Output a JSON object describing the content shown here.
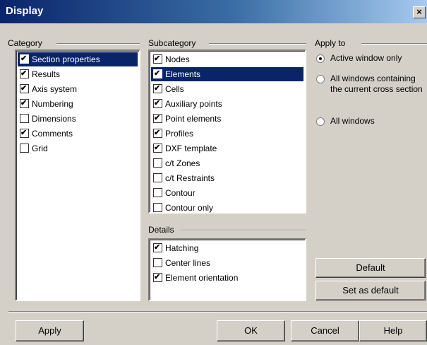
{
  "window": {
    "title": "Display",
    "close_glyph": "×"
  },
  "category": {
    "label": "Category",
    "items": [
      {
        "label": "Section properties",
        "checked": true,
        "selected": true
      },
      {
        "label": "Results",
        "checked": true,
        "selected": false
      },
      {
        "label": "Axis system",
        "checked": true,
        "selected": false
      },
      {
        "label": "Numbering",
        "checked": true,
        "selected": false
      },
      {
        "label": "Dimensions",
        "checked": false,
        "selected": false
      },
      {
        "label": "Comments",
        "checked": true,
        "selected": false
      },
      {
        "label": "Grid",
        "checked": false,
        "selected": false
      }
    ]
  },
  "subcategory": {
    "label": "Subcategory",
    "items": [
      {
        "label": "Nodes",
        "checked": true,
        "selected": false
      },
      {
        "label": "Elements",
        "checked": true,
        "selected": true
      },
      {
        "label": "Cells",
        "checked": true,
        "selected": false
      },
      {
        "label": "Auxiliary points",
        "checked": true,
        "selected": false
      },
      {
        "label": "Point elements",
        "checked": true,
        "selected": false
      },
      {
        "label": "Profiles",
        "checked": true,
        "selected": false
      },
      {
        "label": "DXF template",
        "checked": true,
        "selected": false
      },
      {
        "label": "c/t Zones",
        "checked": false,
        "selected": false
      },
      {
        "label": "c/t Restraints",
        "checked": false,
        "selected": false
      },
      {
        "label": "Contour",
        "checked": false,
        "selected": false
      },
      {
        "label": "Contour only",
        "checked": false,
        "selected": false
      }
    ]
  },
  "details": {
    "label": "Details",
    "items": [
      {
        "label": "Hatching",
        "checked": true,
        "selected": false
      },
      {
        "label": "Center lines",
        "checked": false,
        "selected": false
      },
      {
        "label": "Element orientation",
        "checked": true,
        "selected": false
      }
    ]
  },
  "apply_to": {
    "label": "Apply to",
    "options": [
      {
        "label": "Active window only",
        "selected": true
      },
      {
        "label": "All windows containing the current cross section",
        "selected": false
      },
      {
        "label": "All windows",
        "selected": false
      }
    ]
  },
  "buttons": {
    "default": "Default",
    "set_as_default": "Set as default",
    "apply": "Apply",
    "ok": "OK",
    "cancel": "Cancel",
    "help": "Help"
  },
  "colors": {
    "selection": "#0a246a",
    "face": "#d4d0c8",
    "titlebar_start": "#0a246a",
    "titlebar_end": "#a6caf0"
  }
}
